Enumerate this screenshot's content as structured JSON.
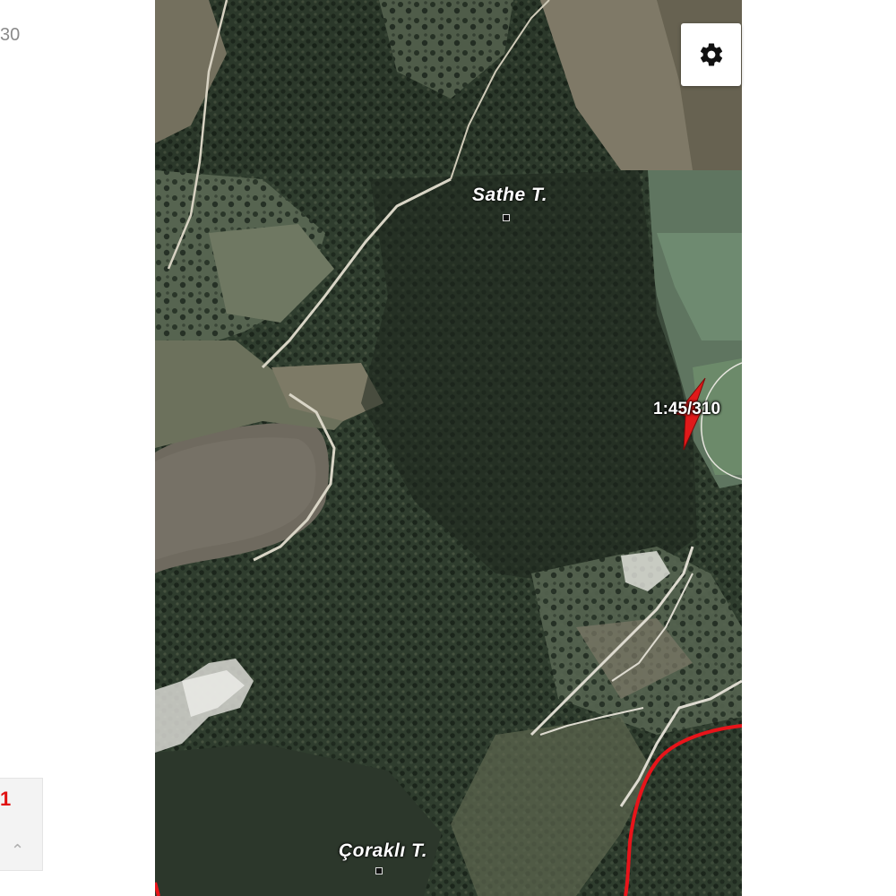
{
  "left_panel": {
    "fragment_text": "30",
    "widget_mark": "1"
  },
  "map": {
    "type": "satellite",
    "settings_icon": "gear-icon",
    "labels": [
      {
        "text": "Sathe T.",
        "kind": "peak"
      },
      {
        "text": "Çoraklı T.",
        "kind": "peak"
      }
    ],
    "position_marker": {
      "label": "1:45/310",
      "icon": "location-arrow-icon",
      "color": "#e01a1a"
    },
    "track_color": "#e8141a"
  }
}
